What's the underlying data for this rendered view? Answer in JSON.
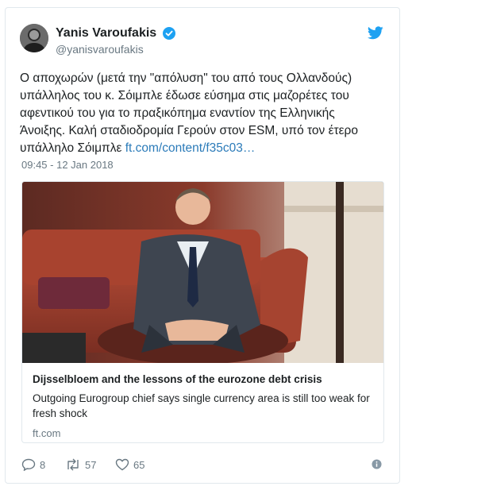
{
  "user": {
    "display_name": "Yanis Varoufakis",
    "handle": "@yanisvaroufakis",
    "verified": true,
    "avatar_icon": "portrait-avatar"
  },
  "tweet": {
    "text": "Ο αποχωρών (μετά την \"απόλυση\" του από τους Ολλανδούς) υπάλληλος του κ. Σόιμπλε έδωσε εύσημα στις μαζορέτες του αφεντικού του για το πραξικόπημα εναντίον της Ελληνικής Άνοιξης. Καλή σταδιοδρομία Γερούν στον ESM, υπό τον έτερο υπάλληλο Σόιμπλε ",
    "link_text": "ft.com/content/f35c03…",
    "timestamp": "09:45 - 12 Jan 2018"
  },
  "card": {
    "title": "Dijsselbloem and the lessons of the eurozone debt crisis",
    "description": "Outgoing Eurogroup chief says single currency area is still too weak for fresh shock",
    "domain": "ft.com"
  },
  "actions": {
    "replies": "8",
    "retweets": "57",
    "likes": "65"
  },
  "colors": {
    "text": "#1c2022",
    "secondary": "#697882",
    "link": "#2b7bb9",
    "twitter_blue": "#1da1f2",
    "border": "#e1e8ed"
  }
}
